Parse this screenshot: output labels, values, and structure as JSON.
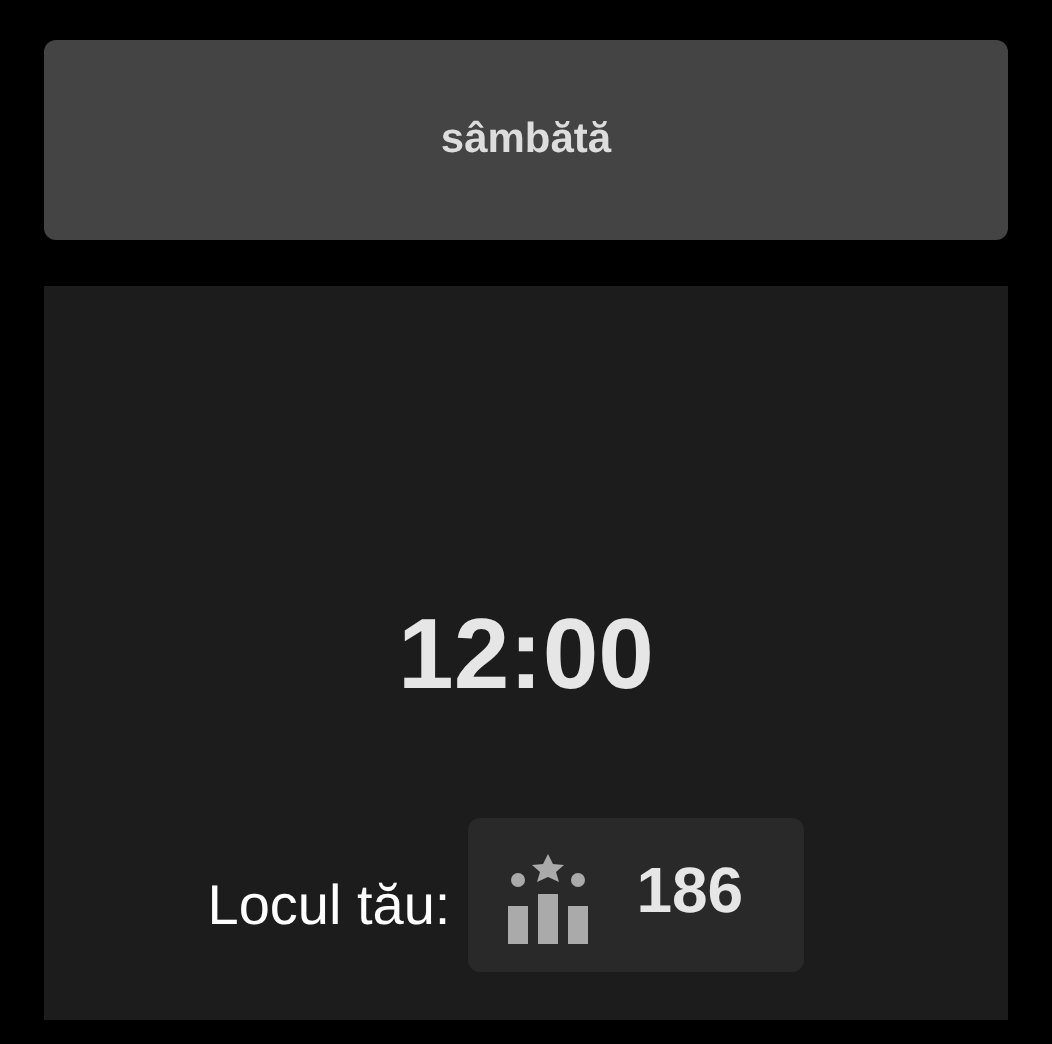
{
  "day_header": {
    "label": "sâmbătă"
  },
  "time": "12:00",
  "rank": {
    "label": "Locul tău:",
    "value": "186"
  }
}
